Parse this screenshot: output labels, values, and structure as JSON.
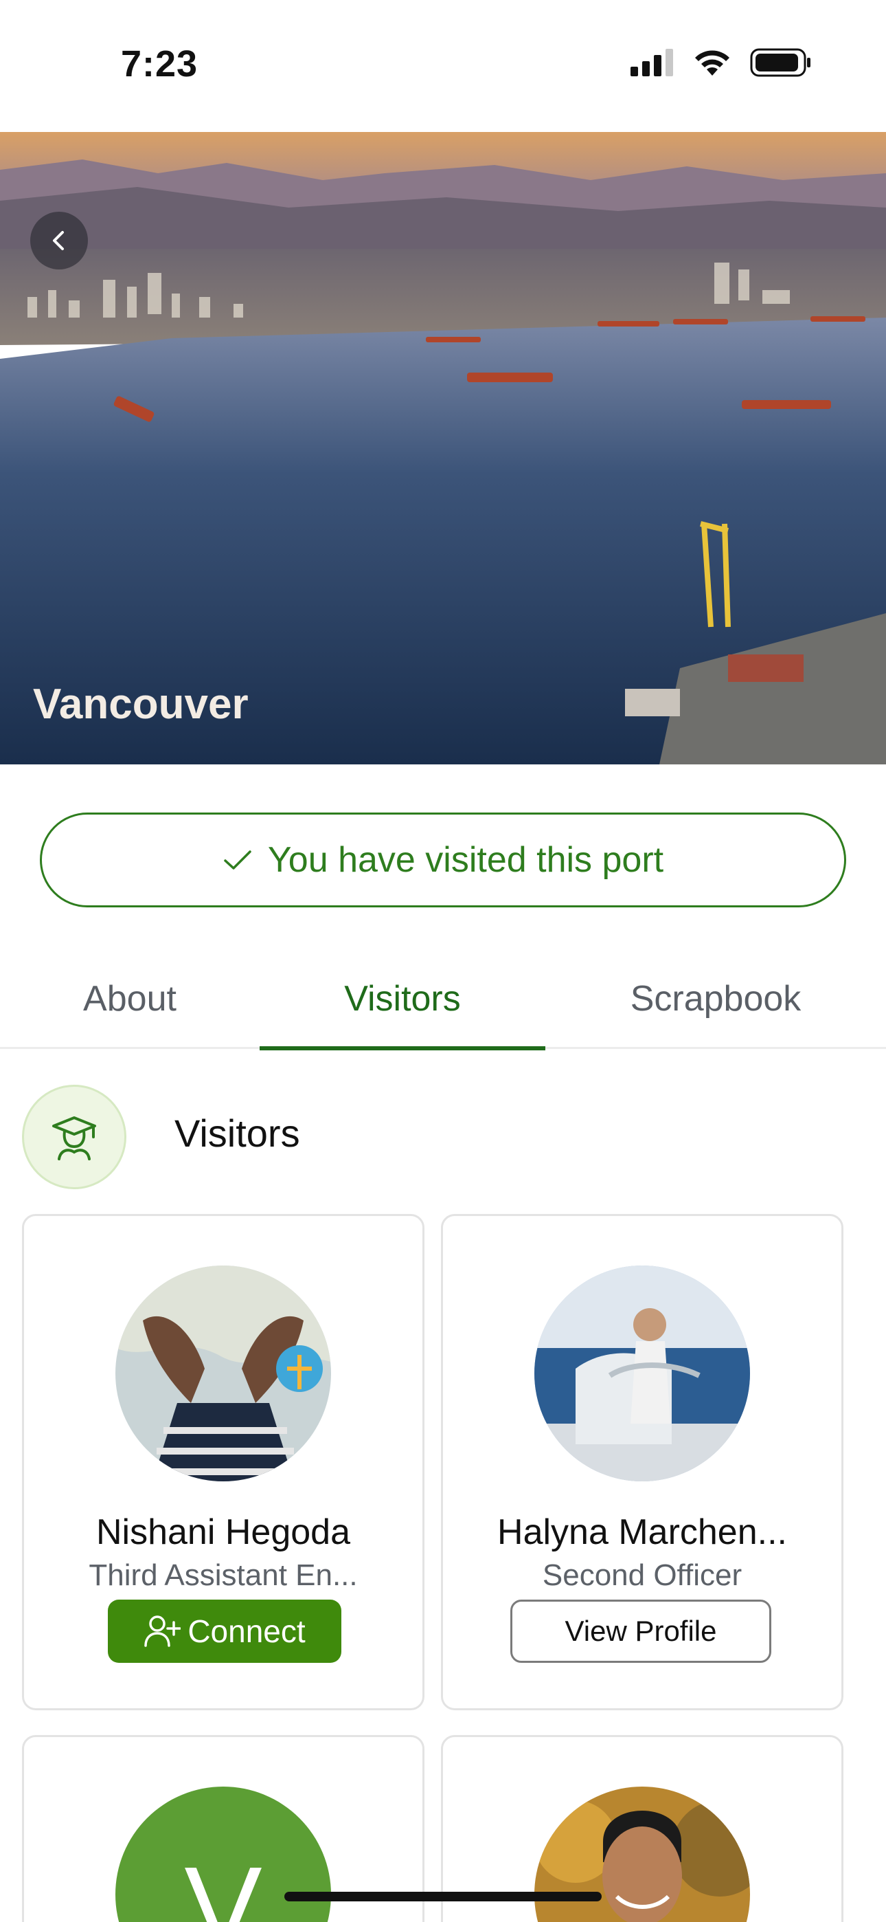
{
  "status_bar": {
    "time": "7:23"
  },
  "hero": {
    "title": "Vancouver"
  },
  "visited_banner": {
    "text": "You have visited this port"
  },
  "tabs": [
    {
      "label": "About",
      "active": false
    },
    {
      "label": "Visitors",
      "active": true
    },
    {
      "label": "Scrapbook",
      "active": false
    }
  ],
  "section": {
    "title": "Visitors",
    "icon": "graduate-icon"
  },
  "visitors": [
    {
      "name": "Nishani Hegoda",
      "role": "Third Assistant En...",
      "action": "Connect",
      "action_icon": "add-user-icon"
    },
    {
      "name": "Halyna Marchen...",
      "role": "Second Officer",
      "action": "View Profile"
    },
    {
      "initial": "V"
    },
    {
      "name": ""
    }
  ],
  "colors": {
    "accent_green": "#1f6b1a",
    "button_green": "#3f8a0c",
    "avatar_green": "#5c9e34"
  }
}
